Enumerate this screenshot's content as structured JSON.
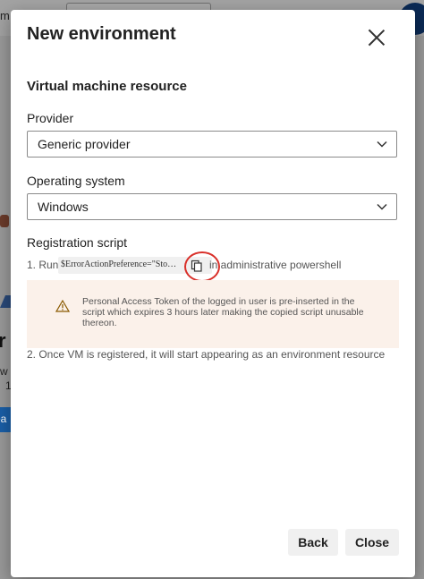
{
  "background": {
    "left_fragments": [
      "m",
      "w r",
      "1"
    ],
    "button_fragment": "ea"
  },
  "dialog": {
    "title": "New environment",
    "close_icon": "close-icon",
    "section_heading": "Virtual machine resource",
    "provider": {
      "label": "Provider",
      "value": "Generic provider"
    },
    "os": {
      "label": "Operating system",
      "value": "Windows"
    },
    "registration": {
      "label": "Registration script",
      "step1_prefix": "1. Run",
      "code_snippet": "$ErrorActionPreference=\"Sto…",
      "step1_suffix": "in administrative powershell",
      "copy_icon": "copy-icon",
      "warning_icon": "warning-icon",
      "warning_text": "Personal Access Token of the logged in user is pre-inserted in the script which expires 3 hours later making the copied script unusable thereon.",
      "step2": "2. Once VM is registered, it will start appearing as an environment resource"
    },
    "buttons": {
      "back": "Back",
      "close": "Close"
    }
  },
  "colors": {
    "annotation_ring": "#d9302a",
    "warning_bg": "#fbf1ea"
  }
}
